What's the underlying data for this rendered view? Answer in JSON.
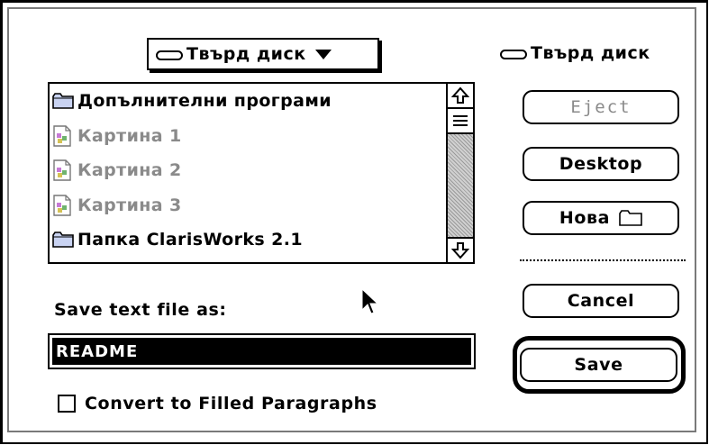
{
  "popup": {
    "label": "Твърд диск"
  },
  "volume": {
    "label": "Твърд диск"
  },
  "file_list": {
    "items": [
      {
        "label": "Допълнителни програми",
        "kind": "folder",
        "enabled": true
      },
      {
        "label": "Картина 1",
        "kind": "document",
        "enabled": false
      },
      {
        "label": "Картина 2",
        "kind": "document",
        "enabled": false
      },
      {
        "label": "Картина 3",
        "kind": "document",
        "enabled": false
      },
      {
        "label": "Папка ClarisWorks 2.1",
        "kind": "folder",
        "enabled": true
      }
    ]
  },
  "buttons": {
    "eject": "Eject",
    "desktop": "Desktop",
    "new_folder": "Нова",
    "cancel": "Cancel",
    "save": "Save"
  },
  "save_prompt": "Save text file as:",
  "filename": {
    "value": "README"
  },
  "convert_option": {
    "label": "Convert to Filled Paragraphs",
    "checked": false
  },
  "icons": {
    "folder": "folder-icon",
    "document": "document-icon",
    "disk": "disk-icon",
    "cursor": "arrow-cursor-icon"
  }
}
